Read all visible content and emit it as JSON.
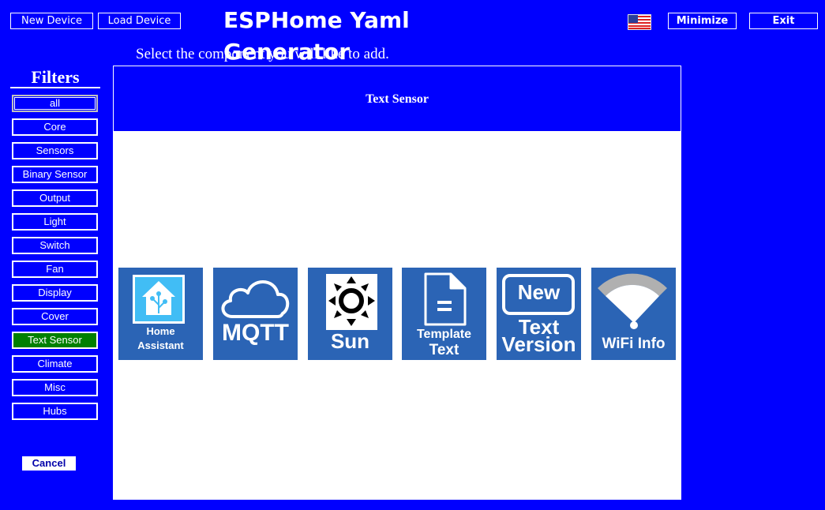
{
  "header": {
    "new_device": "New Device",
    "load_device": "Load Device",
    "title": "ESPHome Yaml Generator",
    "minimize": "Minimize",
    "exit": "Exit"
  },
  "prompt": "Select the component you will like to add.",
  "filters": {
    "title": "Filters",
    "items": [
      "all",
      "Core",
      "Sensors",
      "Binary Sensor",
      "Output",
      "Light",
      "Switch",
      "Fan",
      "Display",
      "Cover",
      "Text Sensor",
      "Climate",
      "Misc",
      "Hubs"
    ],
    "active": "Text Sensor"
  },
  "cancel": "Cancel",
  "panel": {
    "title": "Text Sensor",
    "tiles": [
      {
        "line1": "Home",
        "line2": "Assistant",
        "icon": "home-assistant-icon"
      },
      {
        "line1": "MQTT",
        "icon": "cloud-icon"
      },
      {
        "line1": "Sun",
        "icon": "sun-icon"
      },
      {
        "line1": "Template",
        "line2": "Text",
        "icon": "document-icon"
      },
      {
        "line1": "New",
        "line2": "Text",
        "line3": "Version",
        "icon": "new-badge-icon"
      },
      {
        "line1": "WiFi Info",
        "icon": "wifi-icon"
      }
    ]
  },
  "colors": {
    "background": "#0000ff",
    "active_filter": "#008000",
    "tile": "#2b64b5",
    "panel": "#ffffff"
  }
}
